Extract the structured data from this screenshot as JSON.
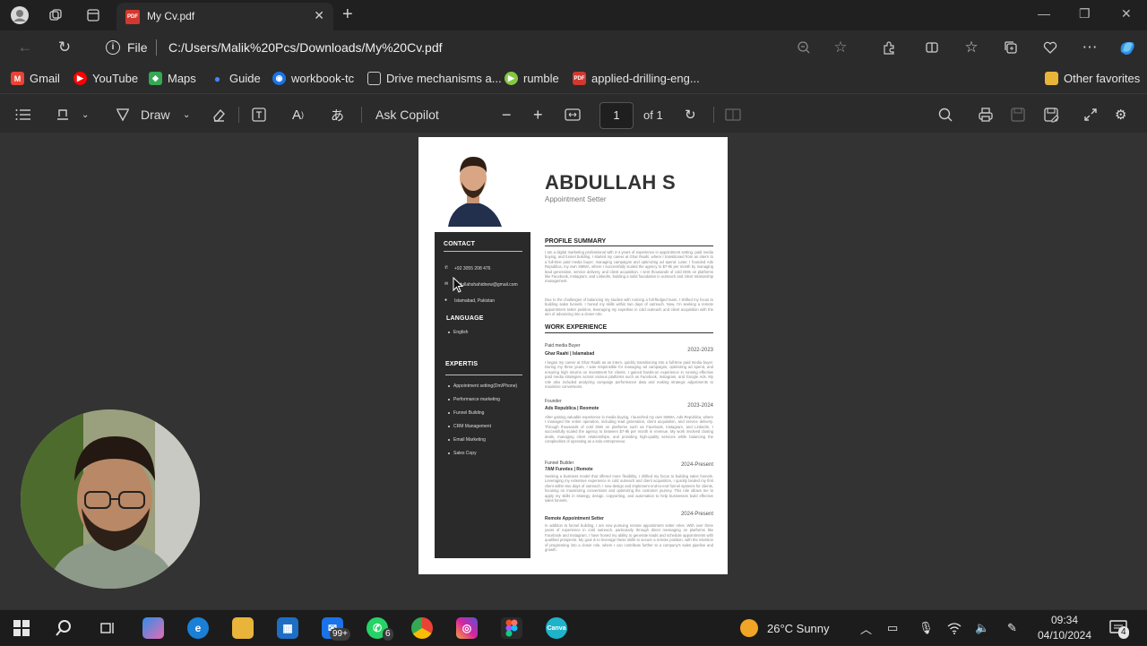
{
  "browser": {
    "tab_title": "My Cv.pdf",
    "address_scheme": "File",
    "address_path": "C:/Users/Malik%20Pcs/Downloads/My%20Cv.pdf"
  },
  "bookmarks": [
    {
      "label": "Gmail",
      "icon": "gmail-icon",
      "color": "#ea4335"
    },
    {
      "label": "YouTube",
      "icon": "youtube-icon",
      "color": "#ff0000"
    },
    {
      "label": "Maps",
      "icon": "maps-icon",
      "color": "#34a853"
    },
    {
      "label": "Guide",
      "icon": "guide-icon",
      "color": "#4285f4"
    },
    {
      "label": "workbook-tc",
      "icon": "workbook-icon",
      "color": "#1a73e8"
    },
    {
      "label": "Drive mechanisms a...",
      "icon": "document-icon",
      "color": "#cccccc"
    },
    {
      "label": "rumble",
      "icon": "rumble-icon",
      "color": "#85c742"
    },
    {
      "label": "applied-drilling-eng...",
      "icon": "pdf-icon",
      "color": "#d2382f"
    }
  ],
  "other_favorites": "Other favorites",
  "pdf_toolbar": {
    "draw_label": "Draw",
    "ask_copilot": "Ask Copilot",
    "page_current": "1",
    "page_total": "of 1"
  },
  "cv": {
    "name": "ABDULLAH S",
    "role": "Appointment Setter",
    "contact_heading": "CONTACT",
    "phone": "+92 3055 208 476",
    "email": "abdullahshahidnew@gmail.com",
    "location": "Islamabad, Pakistan",
    "language_heading": "LANGUAGE",
    "languages": [
      "English"
    ],
    "expertise_heading": "EXPERTIS",
    "expertise": [
      "Appointment setting(Dm/Phone)",
      "Performance marketing",
      "Funnel Building",
      "CRM Management",
      "Email Marketing",
      "Sales Copy"
    ],
    "summary_heading": "PROFILE SUMMARY",
    "summary_p1": "I am a digital marketing professional with 2-4 years of experience in appointment setting, paid media buying, and funnel building. I started my career at Ghar Raahi, where I transitioned from an intern to a full-time paid media buyer, managing campaigns and optimizing ad spend. Later, I founded Ads Republica, my own SMMA, where I successfully scaled the agency to $7-9k per month by managing lead generation, service delivery, and client acquisition. I sent thousands of cold DMs on platforms like Facebook, Instagram, and LinkedIn, building a solid foundation in outreach and client relationship management.",
    "summary_p2": "Due to the challenges of balancing my studies with running a full-fledged team, I shifted my focus to building sales funnels. I honed my skills within two days of outreach. Now, I'm seeking a remote appointment setter position, leveraging my expertise in cold outreach and client acquisition with the aim of advancing into a closer role.",
    "work_heading": "WORK EXPERIENCE",
    "jobs": [
      {
        "title": "Paid media Buyer",
        "company": "Ghar Raahi | Islamabad",
        "dates": "2022-2023",
        "desc": "I began my career at Ghar Raahi as an intern, quickly transitioning into a full-time paid media buyer. During my three years, I was responsible for managing ad campaigns, optimizing ad spend, and ensuring high returns on investment for clients. I gained hands-on experience in running effective paid media strategies across various platforms such as Facebook, Instagram, and Google Ads. My role also included analyzing campaign performance data and making strategic adjustments to maximize conversions."
      },
      {
        "title": "Founder",
        "company": "Ads Republica | Reomote",
        "dates": "2023-2024",
        "desc": "After gaining valuable experience in media buying, I launched my own SMMA, Ads Republica, where I managed the entire operation, including lead generation, client acquisition, and service delivery. Through thousands of cold DMs on platforms such as Facebook, Instagram, and LinkedIn, I successfully scaled the agency to between $7-9k per month in revenue. My work involved closing deals, managing client relationships, and providing high-quality services while balancing the complexities of operating as a solo entrepreneur."
      },
      {
        "title": "Funnel Builder",
        "company": "7AM Funnles | Remote",
        "dates": "2024-Present",
        "desc": "Seeking a business model that offered more flexibility, I shifted my focus to building sales funnels. Leveraging my extensive experience in cold outreach and client acquisition, I quickly landed my first client within two days of outreach. I now design and implement end-to-end funnel systems for clients, focusing on maximizing conversions and optimizing the customer journey. This role allows me to apply my skills in strategy, design, copywriting, and automation to help businesses build effective sales funnels."
      },
      {
        "title": "",
        "company": "Remote Appointment Setter",
        "dates": "2024-Present",
        "desc": "In addition to funnel building, I am now pursuing remote appointment setter roles. With over three years of experience in cold outreach, particularly through direct messaging on platforms like Facebook and Instagram, I have honed my ability to generate leads and schedule appointments with qualified prospects. My goal is to leverage these skills to secure a remote position, with the intention of progressing into a closer role, where I can contribute further to a company's sales pipeline and growth."
      }
    ]
  },
  "taskbar": {
    "mail_badge": "99+",
    "whatsapp_badge": "6",
    "weather": "26°C  Sunny",
    "time": "09:34",
    "date": "04/10/2024",
    "notification_badge": "4"
  }
}
